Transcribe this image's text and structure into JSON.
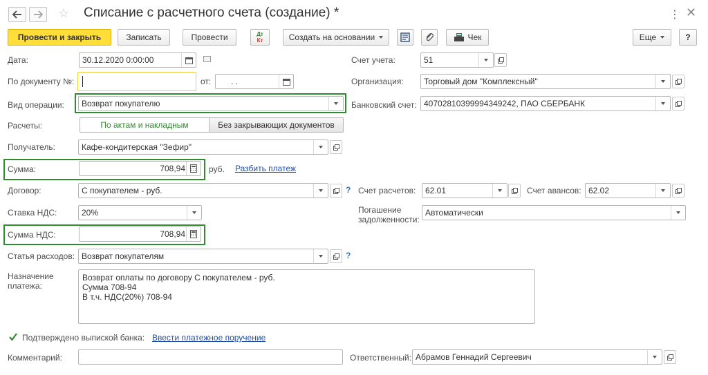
{
  "window": {
    "title": "Списание с расчетного счета (создание) *"
  },
  "toolbar": {
    "post_close": "Провести и закрыть",
    "save": "Записать",
    "post": "Провести",
    "dtkt_top": "Дт",
    "dtkt_bottom": "Кт",
    "create_based": "Создать на основании",
    "check": "Чек",
    "more": "Еще",
    "help": "?"
  },
  "form": {
    "date_label": "Дата:",
    "date_value": "30.12.2020  0:00:00",
    "doc_num_label": "По документу №:",
    "doc_num_value": "",
    "from_label": "от:",
    "from_value": " .  .",
    "operation_label": "Вид операции:",
    "operation_value": "Возврат покупателю",
    "settlements_label": "Расчеты:",
    "settlements_opt1": "По актам и накладным",
    "settlements_opt2": "Без закрывающих документов",
    "recipient_label": "Получатель:",
    "recipient_value": "Кафе-кондитерская \"Зефир\"",
    "sum_label": "Сумма:",
    "sum_value": "708,94",
    "sum_currency": "руб.",
    "split_payment": "Разбить платеж",
    "contract_label": "Договор:",
    "contract_value": "С покупателем - руб.",
    "vat_rate_label": "Ставка НДС:",
    "vat_rate_value": "20%",
    "vat_sum_label": "Сумма НДС:",
    "vat_sum_value": "708,94",
    "expense_label": "Статья расходов:",
    "expense_value": "Возврат покупателям",
    "purpose_label_1": "Назначение",
    "purpose_label_2": "платежа:",
    "purpose_line1": "Возврат оплаты по договору С покупателем - руб.",
    "purpose_line2": "Сумма 708-94",
    "purpose_line3": "В т.ч. НДС(20%) 708-94",
    "confirmed_label": "Подтверждено выпиской банка:",
    "enter_order": "Ввести платежное поручение",
    "comment_label": "Комментарий:",
    "comment_value": "",
    "responsible_label": "Ответственный:",
    "responsible_value": "Абрамов Геннадий Сергеевич",
    "account_label": "Счет учета:",
    "account_value": "51",
    "org_label": "Организация:",
    "org_value": "Торговый дом \"Комплексный\"",
    "bank_label": "Банковский счет:",
    "bank_value": "40702810399994349242, ПАО СБЕРБАНК",
    "settle_account_label": "Счет расчетов:",
    "settle_account_value": "62.01",
    "advance_account_label": "Счет авансов:",
    "advance_account_value": "62.02",
    "debt_label_1": "Погашение",
    "debt_label_2": "задолженности:",
    "debt_value": "Автоматически",
    "help_mark": "?"
  },
  "colors": {
    "accent_yellow": "#ffde3a",
    "highlight_green": "#2e8b2e",
    "link_blue": "#1f4ea8"
  }
}
